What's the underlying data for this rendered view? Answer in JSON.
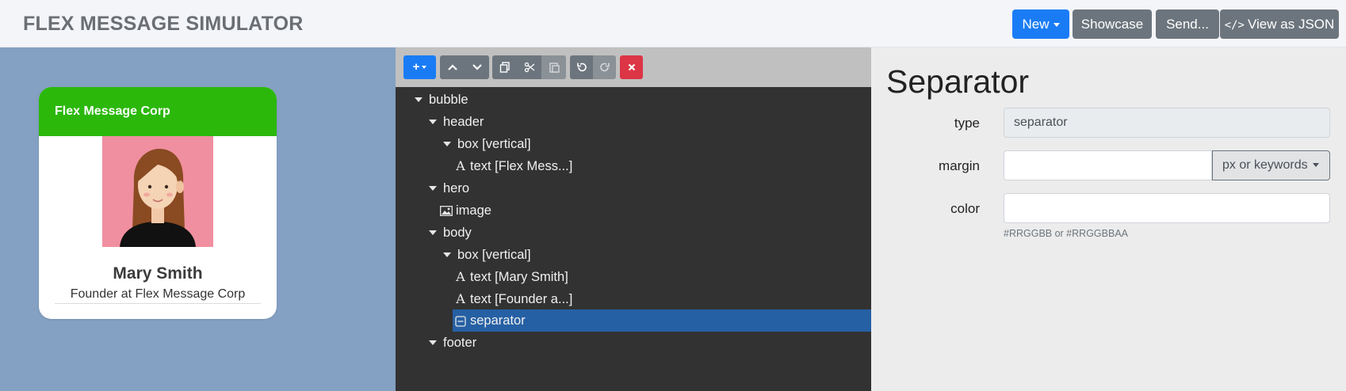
{
  "app": {
    "title": "FLEX MESSAGE SIMULATOR"
  },
  "header_buttons": {
    "new": "New",
    "showcase": "Showcase",
    "send": "Send...",
    "view_json": "View as JSON"
  },
  "preview": {
    "header_text": "Flex Message Corp",
    "name": "Mary Smith",
    "title": "Founder at Flex Message Corp",
    "header_color": "#2bb80b",
    "background_color": "#84a0c2"
  },
  "toolbar": {
    "icons": [
      "add-icon",
      "move-up-icon",
      "move-down-icon",
      "copy-icon",
      "cut-icon",
      "paste-icon",
      "undo-icon",
      "redo-icon",
      "delete-icon"
    ]
  },
  "tree": {
    "items": [
      {
        "label": "bubble"
      },
      {
        "label": "header"
      },
      {
        "label": "box [vertical]"
      },
      {
        "label": "text [Flex Mess...]"
      },
      {
        "label": "hero"
      },
      {
        "label": "image"
      },
      {
        "label": "body"
      },
      {
        "label": "box [vertical]"
      },
      {
        "label": "text [Mary Smith]"
      },
      {
        "label": "text [Founder a...]"
      },
      {
        "label": "separator"
      },
      {
        "label": "footer"
      }
    ],
    "selected": "separator",
    "selected_color": "#2660a4"
  },
  "properties": {
    "heading": "Separator",
    "type_label": "type",
    "type_value": "separator",
    "margin_label": "margin",
    "margin_value": "",
    "margin_unit": "px or keywords",
    "color_label": "color",
    "color_value": "",
    "color_hint": "#RRGGBB or #RRGGBBAA"
  }
}
